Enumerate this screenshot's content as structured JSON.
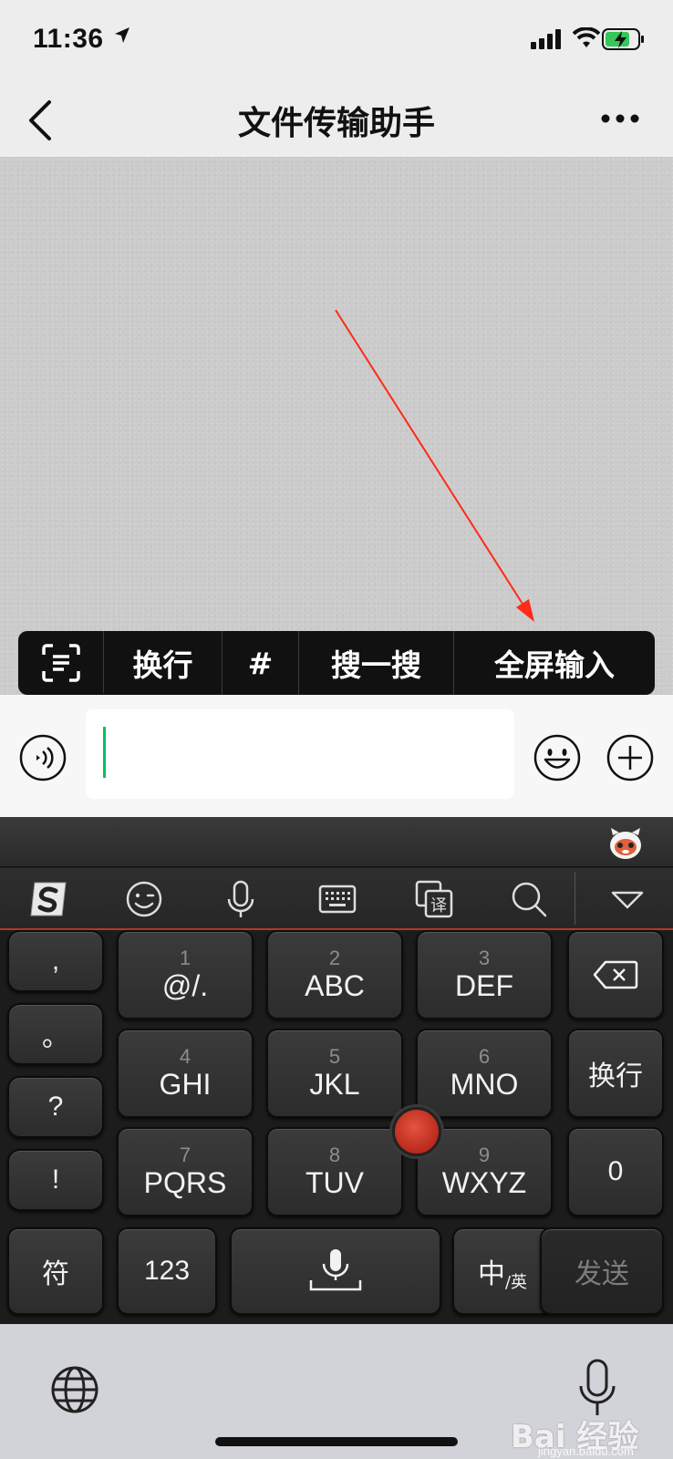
{
  "status_bar": {
    "time": "11:36"
  },
  "nav": {
    "title": "文件传输助手"
  },
  "popup_menu": {
    "items": [
      {
        "id": "scan",
        "icon": "scan-text-icon",
        "label": ""
      },
      {
        "id": "newline",
        "label": "换行"
      },
      {
        "id": "hash",
        "label": "#"
      },
      {
        "id": "search",
        "label": "搜一搜"
      },
      {
        "id": "fullscreen",
        "label": "全屏输入"
      }
    ]
  },
  "input": {
    "value": "",
    "placeholder": ""
  },
  "keyboard": {
    "toolbar_icons": [
      "sogou-logo-icon",
      "emoji-icon",
      "mic-icon",
      "keyboard-icon",
      "translate-icon",
      "search-icon",
      "collapse-icon"
    ],
    "punct_keys": [
      ",",
      "。",
      "?",
      "!"
    ],
    "keys": [
      {
        "num": "1",
        "letters": "@/."
      },
      {
        "num": "2",
        "letters": "ABC"
      },
      {
        "num": "3",
        "letters": "DEF"
      },
      {
        "num": "4",
        "letters": "GHI"
      },
      {
        "num": "5",
        "letters": "JKL"
      },
      {
        "num": "6",
        "letters": "MNO"
      },
      {
        "num": "7",
        "letters": "PQRS"
      },
      {
        "num": "8",
        "letters": "TUV"
      },
      {
        "num": "9",
        "letters": "WXYZ"
      }
    ],
    "right_keys": {
      "newline": "换行",
      "zero": "0",
      "send": "发送"
    },
    "bottom_keys": {
      "symbols": "符",
      "numbers": "123",
      "lang_main": "中",
      "lang_sub": "/英"
    },
    "accent_color": "#c8402f"
  },
  "watermark": {
    "text": "Bai 经验",
    "sub": "jingyan.baidu.com"
  }
}
